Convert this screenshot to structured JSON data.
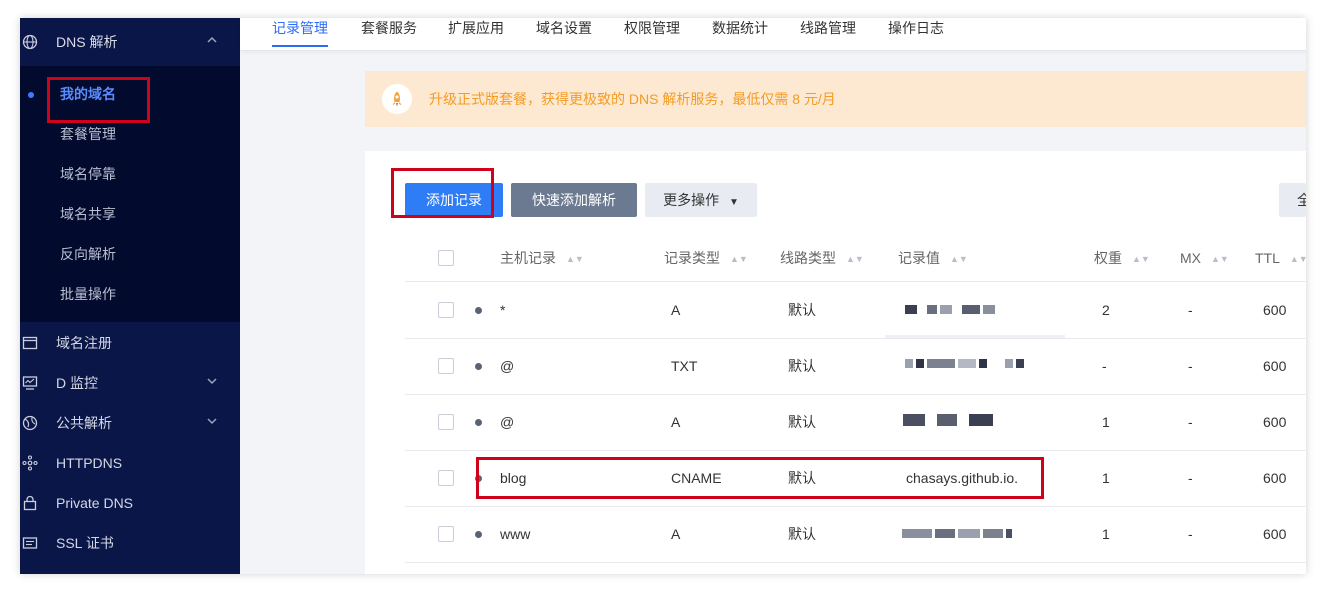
{
  "sidebar": {
    "group": {
      "label": "DNS 解析"
    },
    "sub_items": [
      {
        "label": "我的域名",
        "active": true
      },
      {
        "label": "套餐管理"
      },
      {
        "label": "域名停靠"
      },
      {
        "label": "域名共享"
      },
      {
        "label": "反向解析"
      },
      {
        "label": "批量操作"
      }
    ],
    "items": [
      {
        "label": "域名注册",
        "icon": "window-icon"
      },
      {
        "label": "D 监控",
        "icon": "monitor-icon"
      },
      {
        "label": "公共解析",
        "icon": "globe-icon"
      },
      {
        "label": "HTTPDNS",
        "icon": "network-icon"
      },
      {
        "label": "Private DNS",
        "icon": "lock-icon"
      },
      {
        "label": "SSL 证书",
        "icon": "certificate-icon"
      }
    ]
  },
  "tabs": [
    {
      "label": "记录管理",
      "active": true
    },
    {
      "label": "套餐服务"
    },
    {
      "label": "扩展应用"
    },
    {
      "label": "域名设置"
    },
    {
      "label": "权限管理"
    },
    {
      "label": "数据统计"
    },
    {
      "label": "线路管理"
    },
    {
      "label": "操作日志"
    }
  ],
  "notice": {
    "text": "升级正式版套餐，获得更极致的 DNS 解析服务，最低仅需 8 元/月"
  },
  "toolbar": {
    "add_record": "添加记录",
    "quick_add": "快速添加解析",
    "more_actions": "更多操作",
    "more_arrow": "▼",
    "edge_button": "全"
  },
  "table": {
    "columns": [
      "主机记录",
      "记录类型",
      "线路类型",
      "记录值",
      "权重",
      "MX",
      "TTL"
    ],
    "rows": [
      {
        "host": "*",
        "type": "A",
        "line": "默认",
        "value": "",
        "weight": "2",
        "mx": "-",
        "ttl": "600"
      },
      {
        "host": "@",
        "type": "TXT",
        "line": "默认",
        "value": "",
        "weight": "-",
        "mx": "-",
        "ttl": "600"
      },
      {
        "host": "@",
        "type": "A",
        "line": "默认",
        "value": "",
        "weight": "1",
        "mx": "-",
        "ttl": "600"
      },
      {
        "host": "blog",
        "type": "CNAME",
        "line": "默认",
        "value": "chasays.github.io.",
        "weight": "1",
        "mx": "-",
        "ttl": "600"
      },
      {
        "host": "www",
        "type": "A",
        "line": "默认",
        "value": "",
        "weight": "1",
        "mx": "-",
        "ttl": "600"
      }
    ]
  },
  "colors": {
    "primary": "#2e7cf6",
    "sidebar": "#0b1648",
    "annotation_red": "#d0021b",
    "notice_text": "#f39c25"
  }
}
